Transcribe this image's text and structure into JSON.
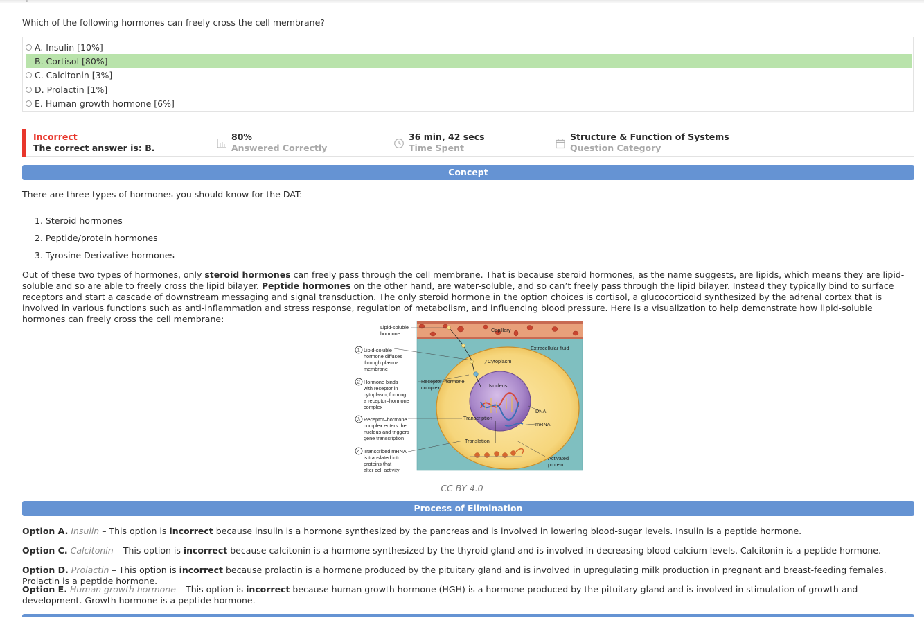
{
  "question": "Which of the following hormones can freely cross the cell membrane?",
  "options": [
    {
      "label": "A. Insulin [10%]",
      "correct": false
    },
    {
      "label": "B. Cortisol [80%]",
      "correct": true
    },
    {
      "label": "C. Calcitonin [3%]",
      "correct": false
    },
    {
      "label": "D. Prolactin [1%]",
      "correct": false
    },
    {
      "label": "E. Human growth hormone [6%]",
      "correct": false
    }
  ],
  "result": {
    "status": "Incorrect",
    "correct_answer": "The correct answer is: B."
  },
  "stats": {
    "answered": {
      "value": "80%",
      "label": "Answered Correctly",
      "icon": "bar-chart-icon"
    },
    "time": {
      "value": "36 min, 42 secs",
      "label": "Time Spent",
      "icon": "clock-icon"
    },
    "category": {
      "value": "Structure & Function of Systems",
      "label": "Question Category",
      "icon": "calendar-icon"
    }
  },
  "concept": {
    "heading": "Concept",
    "intro": "There are three types of hormones you should know for the DAT:",
    "list": [
      "1. Steroid hormones",
      "2. Peptide/protein hormones",
      "3. Tyrosine Derivative hormones"
    ],
    "para": {
      "t1": "Out of these two types of hormones, only ",
      "b1": "steroid hormones",
      "t2": " can freely pass through the cell membrane. That is because steroid hormones, as the name suggests, are lipids, which means they are lipid-soluble and so are able to freely cross the lipid bilayer. ",
      "b2": "Peptide hormones",
      "t3": " on the other hand, are water-soluble, and so can’t freely pass through the lipid bilayer. Instead they typically bind to surface receptors and start a cascade of downstream messaging and signal transduction. The only steroid hormone in the option choices is cortisol, a glucocorticoid synthesized by the adrenal cortex that is involved in various functions such as anti-inflammation and stress response, regulation of metabolism, and influencing blood pressure. Here is a visualization to help demonstrate how lipid-soluble hormones can freely cross the cell membrane:"
    },
    "figure": {
      "lipid_hormone": [
        "Lipid-soluble",
        "hormone"
      ],
      "capillary": "Capillary",
      "extracellular": "Extracellular fluid",
      "cytoplasm": "Cytoplasm",
      "nucleus": "Nucleus",
      "receptor_complex": [
        "Receptor–hormone",
        "complex"
      ],
      "dna": "DNA",
      "mrna": "mRNA",
      "transcription": "Transcription",
      "translation": "Translation",
      "activated_protein": [
        "Activated",
        "protein"
      ],
      "steps": [
        {
          "num": "1",
          "lines": [
            "Lipid-soluble",
            "hormone diffuses",
            "through plasma",
            "membrane"
          ]
        },
        {
          "num": "2",
          "lines": [
            "Hormone binds",
            "with receptor in",
            "cytoplasm, forming",
            "a receptor–hormone",
            "complex"
          ]
        },
        {
          "num": "3",
          "lines": [
            "Receptor–hormone",
            "complex enters the",
            "nucleus and triggers",
            "gene transcription"
          ]
        },
        {
          "num": "4",
          "lines": [
            "Transcribed mRNA",
            "is translated into",
            "proteins that",
            "alter cell activity"
          ]
        }
      ]
    },
    "credit": "CC BY 4.0"
  },
  "elimination": {
    "heading": "Process of Elimination",
    "items": [
      {
        "opt": "Option A.",
        "name": "Insulin",
        "pre": " – This option is ",
        "verdict": "incorrect",
        "rest": " because insulin is a hormone synthesized by the pancreas and is involved in lowering blood-sugar levels. Insulin is a peptide hormone."
      },
      {
        "opt": "Option C.",
        "name": "Calcitonin",
        "pre": " – This option is ",
        "verdict": "incorrect",
        "rest": " because calcitonin is a hormone synthesized by the thyroid gland and is involved in decreasing blood calcium levels. Calcitonin is a peptide hormone."
      },
      {
        "opt": "Option D.",
        "name": "Prolactin",
        "pre": " – This option is ",
        "verdict": "incorrect",
        "rest": " because prolactin is a hormone produced by the pituitary gland and is involved in upregulating milk production in pregnant and breast-feeding females. Prolactin is a peptide hormone."
      },
      {
        "opt": "Option E.",
        "name": "Human growth hormone",
        "pre": " – This option is ",
        "verdict": "incorrect",
        "rest": " because human growth hormone (HGH) is a hormone produced by the pituitary gland and is involved in stimulation of growth and development. Growth hormone is a peptide hormone."
      }
    ]
  },
  "colors": {
    "correct_bg": "#b9e3ab",
    "incorrect": "#e8362b",
    "banner": "#6593d3"
  }
}
